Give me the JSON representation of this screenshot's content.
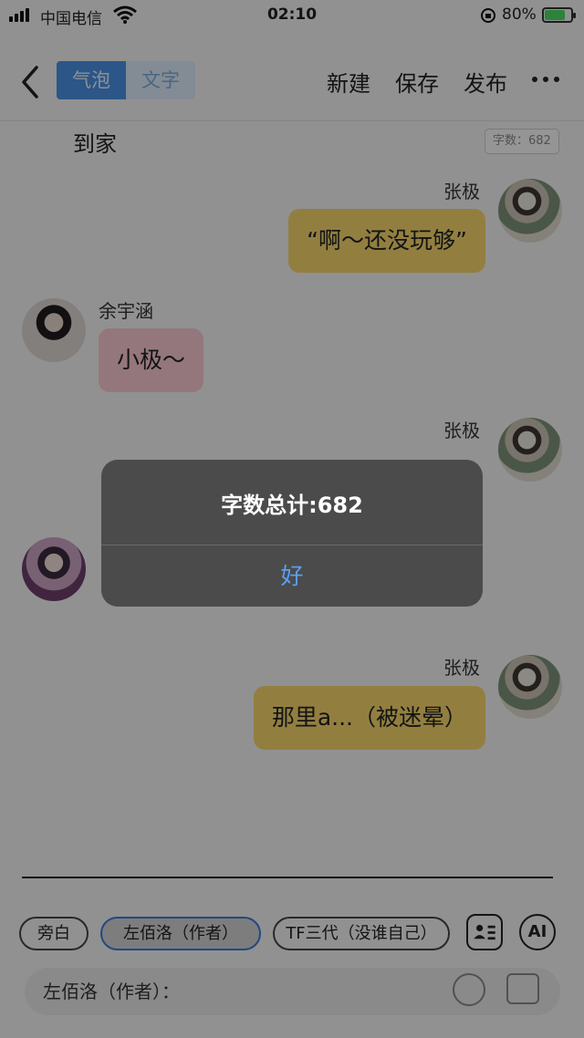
{
  "status": {
    "carrier": "中国电信",
    "time": "02:10",
    "battery": "80%",
    "battery_level": 0.8
  },
  "nav": {
    "mode_bubble": "气泡",
    "mode_text": "文字",
    "new": "新建",
    "save": "保存",
    "publish": "发布"
  },
  "narration": "到家",
  "word_count_badge": "字数：682",
  "messages": [
    {
      "speaker": "张极",
      "text": "“啊～还没玩够”"
    },
    {
      "speaker": "余宇涵",
      "text": "小极～"
    },
    {
      "speaker": "张极",
      "text": ""
    },
    {
      "speaker": "",
      "text": ""
    },
    {
      "speaker": "张极",
      "text": "那里a...（被迷晕）"
    }
  ],
  "dialog": {
    "message": "字数总计:682",
    "ok": "好"
  },
  "chips": {
    "narrator": "旁白",
    "author": "左佰洛（作者）",
    "tf": "TF三代（没谁自己）",
    "ai": "AI"
  },
  "input": {
    "placeholder": "左佰洛（作者）："
  }
}
